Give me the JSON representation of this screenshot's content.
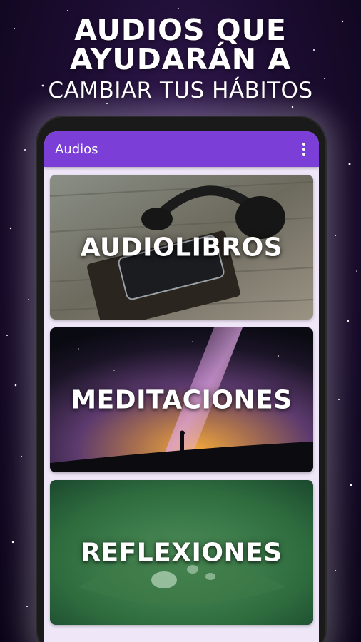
{
  "promo": {
    "line1": "AUDIOS QUE",
    "line2": "AYUDARÁN A",
    "line3": "CAMBIAR TUS HÁBITOS"
  },
  "app": {
    "title": "Audios",
    "accent": "#7b3fd8",
    "menu_icon": "more-vert-icon"
  },
  "cards": [
    {
      "label": "AUDIOLIBROS",
      "image": "headphones-book-phone"
    },
    {
      "label": "MEDITACIONES",
      "image": "milky-way-silhouette"
    },
    {
      "label": "REFLEXIONES",
      "image": "water-drop-leaf"
    }
  ]
}
